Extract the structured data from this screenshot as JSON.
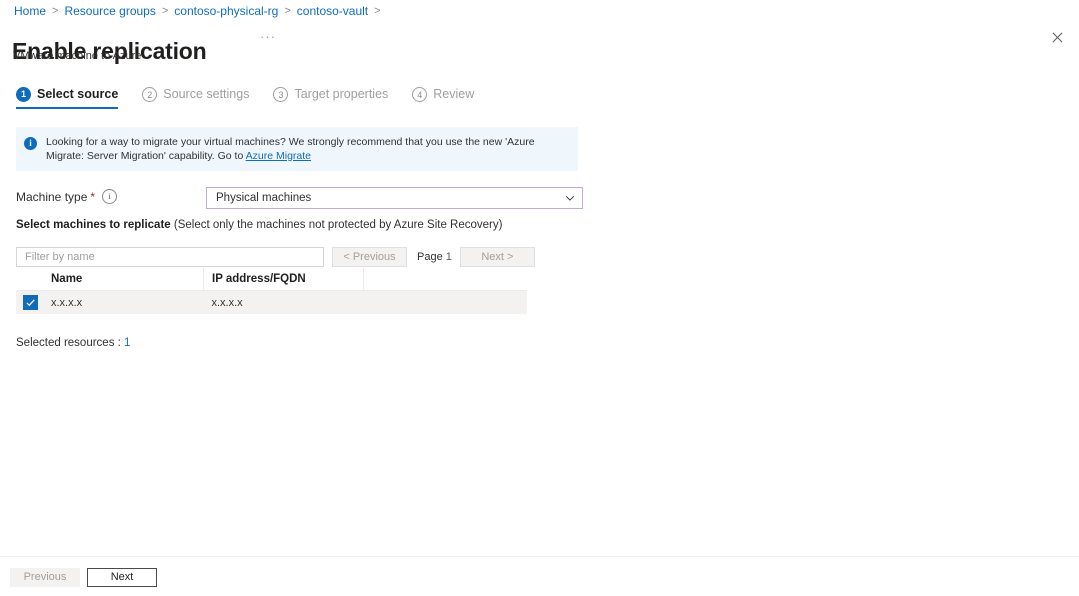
{
  "breadcrumb": {
    "items": [
      {
        "label": "Home"
      },
      {
        "label": "Resource groups"
      },
      {
        "label": "contoso-physical-rg"
      },
      {
        "label": "contoso-vault"
      }
    ],
    "separator": ">"
  },
  "header": {
    "title": "Enable replication",
    "subtitle": "VMware machine to Azure",
    "ellipsis": "···",
    "close_label": "✕"
  },
  "steps": [
    {
      "number": "1",
      "label": "Select source",
      "state": "active"
    },
    {
      "number": "2",
      "label": "Source settings",
      "state": "inactive"
    },
    {
      "number": "3",
      "label": "Target properties",
      "state": "inactive"
    },
    {
      "number": "4",
      "label": "Review",
      "state": "inactive"
    }
  ],
  "info_banner": {
    "icon": "info-icon",
    "text_before": "Looking for a way to migrate your virtual machines? We strongly recommend that you use the new 'Azure Migrate: Server Migration' capability. Go to ",
    "link_text": "Azure Migrate"
  },
  "machine_type": {
    "label": "Machine type",
    "required_marker": "*",
    "tooltip_icon": "info-circle-icon",
    "selected_value": "Physical machines",
    "options": [
      "Physical machines"
    ]
  },
  "section": {
    "heading_bold": "Select machines to replicate",
    "heading_rest": " (Select only the machines not protected by Azure Site Recovery)"
  },
  "toolbar": {
    "filter_placeholder": "Filter by name",
    "filter_value": "",
    "previous_label": "< Previous",
    "page_label": "Page",
    "page_number": "1",
    "next_label": "Next >"
  },
  "table": {
    "columns": [
      "",
      "Name",
      "IP address/FQDN",
      ""
    ],
    "rows": [
      {
        "selected": true,
        "name": "x.x.x.x",
        "ip": "x.x.x.x"
      }
    ]
  },
  "selected_resources": {
    "label": "Selected resources : ",
    "count": "1"
  },
  "footer": {
    "previous_label": "Previous",
    "next_label": "Next"
  },
  "colors": {
    "accent": "#0f6cbd",
    "banner_bg": "#eff6fc",
    "row_selected_bg": "#f3f2f1",
    "dropdown_border": "#c8a9ce",
    "required_star": "#a4262c"
  }
}
